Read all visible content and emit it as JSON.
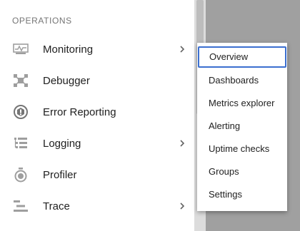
{
  "sidebar": {
    "section_header": "OPERATIONS",
    "items": [
      {
        "label": "Monitoring",
        "icon": "monitoring-icon",
        "has_submenu": true
      },
      {
        "label": "Debugger",
        "icon": "debugger-icon",
        "has_submenu": false
      },
      {
        "label": "Error Reporting",
        "icon": "error-reporting-icon",
        "has_submenu": false
      },
      {
        "label": "Logging",
        "icon": "logging-icon",
        "has_submenu": true
      },
      {
        "label": "Profiler",
        "icon": "profiler-icon",
        "has_submenu": false
      },
      {
        "label": "Trace",
        "icon": "trace-icon",
        "has_submenu": true
      }
    ]
  },
  "flyout": {
    "items": [
      {
        "label": "Overview",
        "focused": true
      },
      {
        "label": "Dashboards"
      },
      {
        "label": "Metrics explorer"
      },
      {
        "label": "Alerting"
      },
      {
        "label": "Uptime checks"
      },
      {
        "label": "Groups"
      },
      {
        "label": "Settings"
      }
    ]
  },
  "colors": {
    "focus_ring": "#3b6fd0",
    "icon": "#757575",
    "overlay": "#9e9e9e"
  }
}
